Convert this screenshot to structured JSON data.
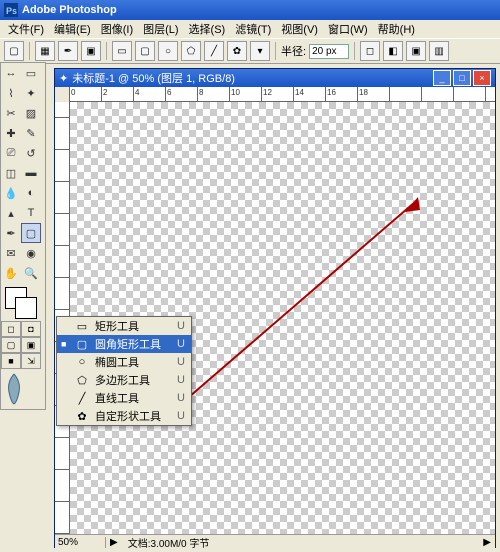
{
  "app_title": "Adobe Photoshop",
  "menus": [
    "文件(F)",
    "编辑(E)",
    "图像(I)",
    "图层(L)",
    "选择(S)",
    "滤镜(T)",
    "视图(V)",
    "窗口(W)",
    "帮助(H)"
  ],
  "option_bar": {
    "radius_label": "半径:",
    "radius_value": "20 px"
  },
  "document": {
    "title": "未标题-1 @ 50% (图层 1, RGB/8)",
    "zoom": "50%",
    "status": "文档:3.00M/0 字节"
  },
  "ruler_ticks": [
    "0",
    "2",
    "4",
    "6",
    "8",
    "10",
    "12",
    "14",
    "16",
    "18"
  ],
  "tools": [
    {
      "name": "move",
      "glyph": "↔"
    },
    {
      "name": "marquee",
      "glyph": "▭"
    },
    {
      "name": "lasso",
      "glyph": "⌇"
    },
    {
      "name": "wand",
      "glyph": "✦"
    },
    {
      "name": "crop",
      "glyph": "✂"
    },
    {
      "name": "slice",
      "glyph": "▨"
    },
    {
      "name": "healing",
      "glyph": "✚"
    },
    {
      "name": "brush",
      "glyph": "✎"
    },
    {
      "name": "stamp",
      "glyph": "⎚"
    },
    {
      "name": "history-brush",
      "glyph": "↺"
    },
    {
      "name": "eraser",
      "glyph": "◫"
    },
    {
      "name": "gradient",
      "glyph": "▬"
    },
    {
      "name": "blur",
      "glyph": "💧"
    },
    {
      "name": "dodge",
      "glyph": "◐"
    },
    {
      "name": "path-select",
      "glyph": "▴"
    },
    {
      "name": "type",
      "glyph": "T"
    },
    {
      "name": "pen",
      "glyph": "✒"
    },
    {
      "name": "shape",
      "glyph": "▢",
      "selected": true
    },
    {
      "name": "notes",
      "glyph": "✉"
    },
    {
      "name": "eyedropper",
      "glyph": "◉"
    },
    {
      "name": "hand",
      "glyph": "✋"
    },
    {
      "name": "zoom",
      "glyph": "🔍"
    }
  ],
  "shape_flyout": [
    {
      "icon": "▭",
      "label": "矩形工具",
      "key": "U",
      "sel": false
    },
    {
      "icon": "▢",
      "label": "圆角矩形工具",
      "key": "U",
      "sel": true
    },
    {
      "icon": "○",
      "label": "椭圆工具",
      "key": "U",
      "sel": false
    },
    {
      "icon": "⬠",
      "label": "多边形工具",
      "key": "U",
      "sel": false
    },
    {
      "icon": "╱",
      "label": "直线工具",
      "key": "U",
      "sel": false
    },
    {
      "icon": "✿",
      "label": "自定形状工具",
      "key": "U",
      "sel": false
    }
  ]
}
